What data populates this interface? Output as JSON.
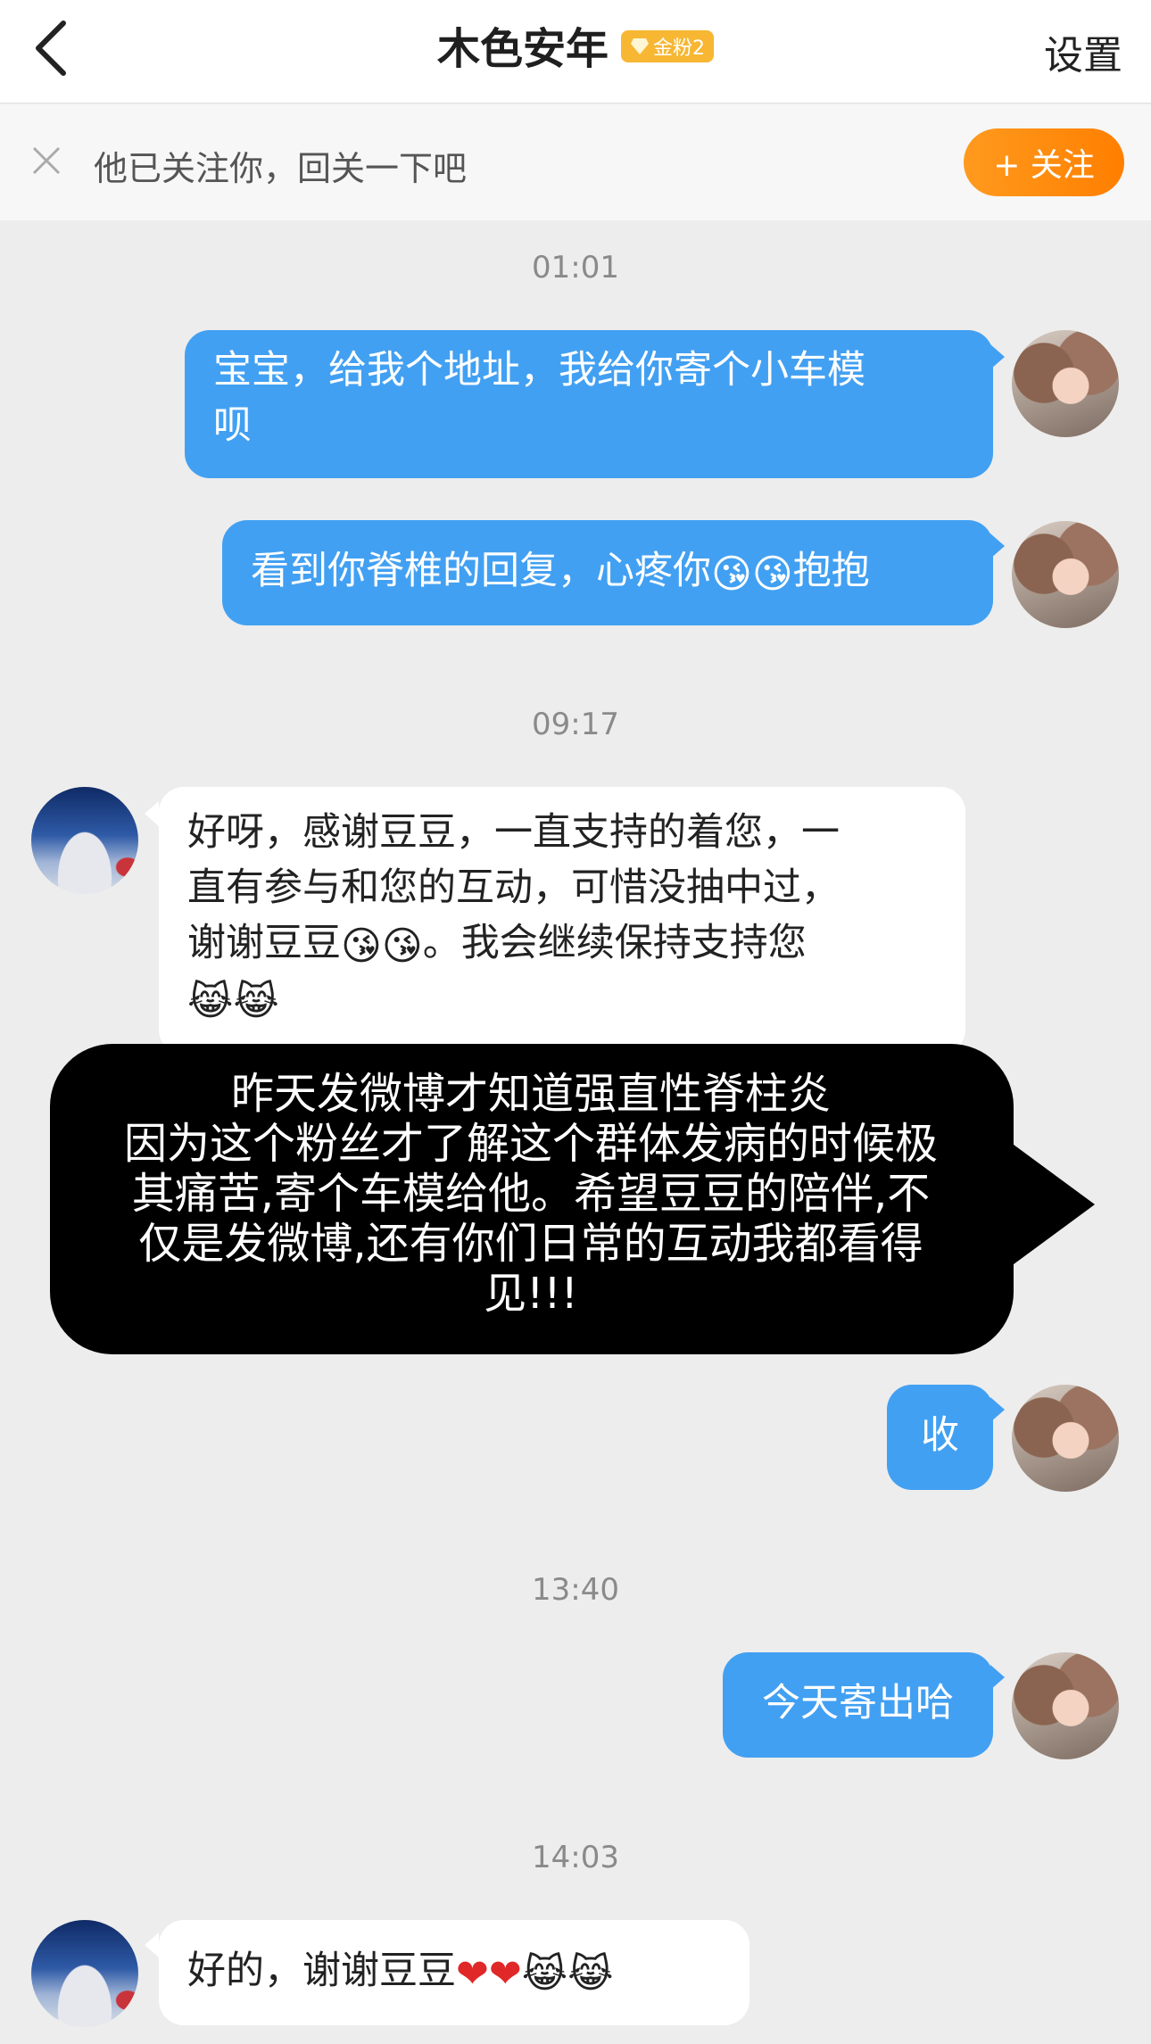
{
  "header": {
    "title": "木色安年",
    "badge": "金粉2",
    "settings_label": "设置"
  },
  "follow_bar": {
    "text": "他已关注你，回关一下吧",
    "follow_button_label": "+ 关注"
  },
  "timestamps": [
    "01:01",
    "09:17",
    "13:40",
    "14:03"
  ],
  "messages": {
    "m1": "宝宝，给我个地址，我给你寄个小车模呗",
    "m1_line1": "宝宝，给我个地址，我给你寄个小车模",
    "m1_line2": "呗",
    "m2_text": "看到你脊椎的回复，心疼你",
    "m2_suffix": "抱抱",
    "m3_line1": "好呀，感谢豆豆，一直支持的着您，一",
    "m3_line2": "直有参与和您的互动，可惜没抽中过，",
    "m3_line3a": "谢谢豆豆",
    "m3_line3b": "。我会继续保持支持您",
    "m4": "收",
    "m5": "今天寄出哈",
    "m6_text": "好的，谢谢豆豆"
  },
  "overlay": {
    "line1": "昨天发微博才知道强直性脊柱炎",
    "line2": "因为这个粉丝才了解这个群体发病的时候极",
    "line3": "其痛苦,寄个车模给他。希望豆豆的陪伴,不",
    "line4": "仅是发微博,还有你们日常的互动我都看得",
    "line5": "见!!!"
  },
  "emoji": {
    "kiss": "😘",
    "laugh": "😹",
    "heart": "❤"
  },
  "colors": {
    "my_bubble": "#42a0f2",
    "their_bubble": "#ffffff",
    "background": "#ededed",
    "follow_button": "#ff8a0f",
    "badge": "#f7b733"
  }
}
